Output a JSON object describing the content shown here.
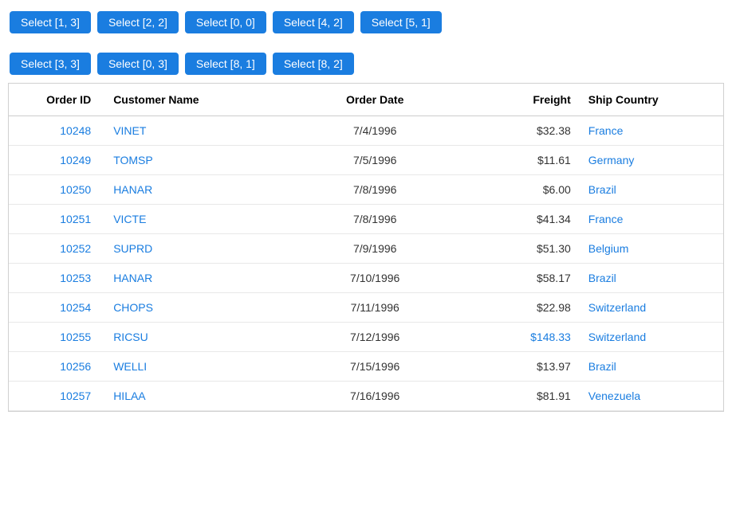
{
  "toolbar": {
    "row1": [
      {
        "label": "Select [1, 3]"
      },
      {
        "label": "Select [2, 2]"
      },
      {
        "label": "Select [0, 0]"
      },
      {
        "label": "Select [4, 2]"
      },
      {
        "label": "Select [5, 1]"
      }
    ],
    "row2": [
      {
        "label": "Select [3, 3]"
      },
      {
        "label": "Select [0, 3]"
      },
      {
        "label": "Select [8, 1]"
      },
      {
        "label": "Select [8, 2]"
      }
    ]
  },
  "table": {
    "columns": [
      {
        "id": "orderid",
        "label": "Order ID"
      },
      {
        "id": "customer",
        "label": "Customer Name"
      },
      {
        "id": "date",
        "label": "Order Date"
      },
      {
        "id": "freight",
        "label": "Freight"
      },
      {
        "id": "country",
        "label": "Ship Country"
      }
    ],
    "rows": [
      {
        "orderid": "10248",
        "customer": "VINET",
        "date": "7/4/1996",
        "freight": "$32.38",
        "country": "France",
        "highlight": false
      },
      {
        "orderid": "10249",
        "customer": "TOMSP",
        "date": "7/5/1996",
        "freight": "$11.61",
        "country": "Germany",
        "highlight": false
      },
      {
        "orderid": "10250",
        "customer": "HANAR",
        "date": "7/8/1996",
        "freight": "$6.00",
        "country": "Brazil",
        "highlight": false
      },
      {
        "orderid": "10251",
        "customer": "VICTE",
        "date": "7/8/1996",
        "freight": "$41.34",
        "country": "France",
        "highlight": false
      },
      {
        "orderid": "10252",
        "customer": "SUPRD",
        "date": "7/9/1996",
        "freight": "$51.30",
        "country": "Belgium",
        "highlight": false
      },
      {
        "orderid": "10253",
        "customer": "HANAR",
        "date": "7/10/1996",
        "freight": "$58.17",
        "country": "Brazil",
        "highlight": false
      },
      {
        "orderid": "10254",
        "customer": "CHOPS",
        "date": "7/11/1996",
        "freight": "$22.98",
        "country": "Switzerland",
        "highlight": false
      },
      {
        "orderid": "10255",
        "customer": "RICSU",
        "date": "7/12/1996",
        "freight": "$148.33",
        "country": "Switzerland",
        "highlight": true
      },
      {
        "orderid": "10256",
        "customer": "WELLI",
        "date": "7/15/1996",
        "freight": "$13.97",
        "country": "Brazil",
        "highlight": false
      },
      {
        "orderid": "10257",
        "customer": "HILAA",
        "date": "7/16/1996",
        "freight": "$81.91",
        "country": "Venezuela",
        "highlight": false
      }
    ]
  }
}
